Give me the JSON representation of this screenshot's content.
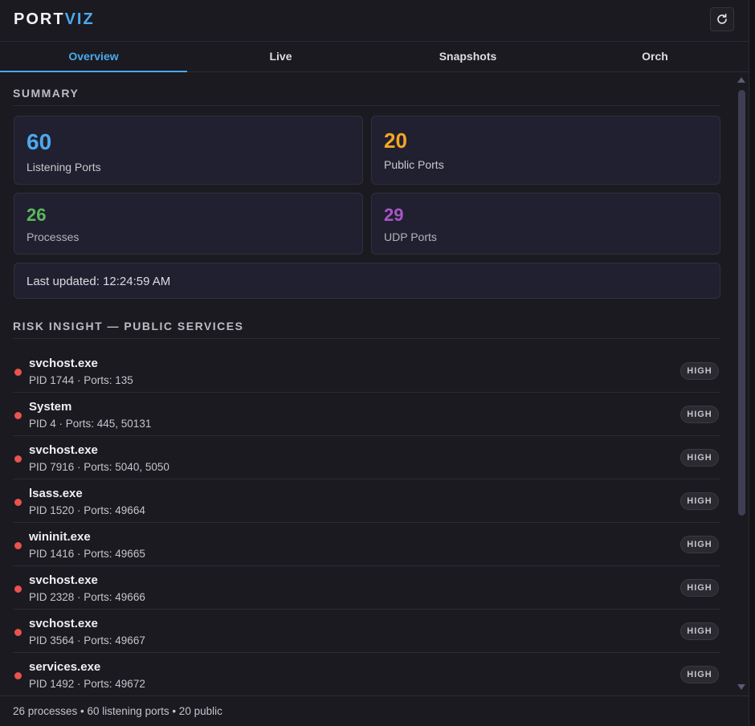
{
  "app": {
    "logo_part1": "PORT",
    "logo_part2": "VIZ",
    "accent_color": "#4da8ee",
    "refresh_icon": "refresh-icon"
  },
  "tabs": [
    {
      "label": "Overview",
      "active": true
    },
    {
      "label": "Live",
      "active": false
    },
    {
      "label": "Snapshots",
      "active": false
    },
    {
      "label": "Orch",
      "active": false
    }
  ],
  "summary": {
    "title": "SUMMARY",
    "cards": [
      {
        "value": "60",
        "label": "Listening Ports",
        "color": "#4da8ee"
      },
      {
        "value": "20",
        "label": "Public Ports",
        "color": "#f5a623"
      },
      {
        "value": "26",
        "label": "Processes",
        "color": "#5cb85c"
      },
      {
        "value": "29",
        "label": "UDP Ports",
        "color": "#a855c7"
      }
    ],
    "last_updated": "Last updated: 12:24:59 AM"
  },
  "risk": {
    "title": "RISK INSIGHT — PUBLIC SERVICES",
    "items": [
      {
        "name": "svchost.exe",
        "meta": "PID 1744 · Ports: 135",
        "level": "HIGH"
      },
      {
        "name": "System",
        "meta": "PID 4 · Ports: 445, 50131",
        "level": "HIGH"
      },
      {
        "name": "svchost.exe",
        "meta": "PID 7916 · Ports: 5040, 5050",
        "level": "HIGH"
      },
      {
        "name": "lsass.exe",
        "meta": "PID 1520 · Ports: 49664",
        "level": "HIGH"
      },
      {
        "name": "wininit.exe",
        "meta": "PID 1416 · Ports: 49665",
        "level": "HIGH"
      },
      {
        "name": "svchost.exe",
        "meta": "PID 2328 · Ports: 49666",
        "level": "HIGH"
      },
      {
        "name": "svchost.exe",
        "meta": "PID 3564 · Ports: 49667",
        "level": "HIGH"
      },
      {
        "name": "services.exe",
        "meta": "PID 1492 · Ports: 49672",
        "level": "HIGH"
      }
    ]
  },
  "footer": {
    "status": "26 processes • 60 listening ports • 20 public"
  }
}
